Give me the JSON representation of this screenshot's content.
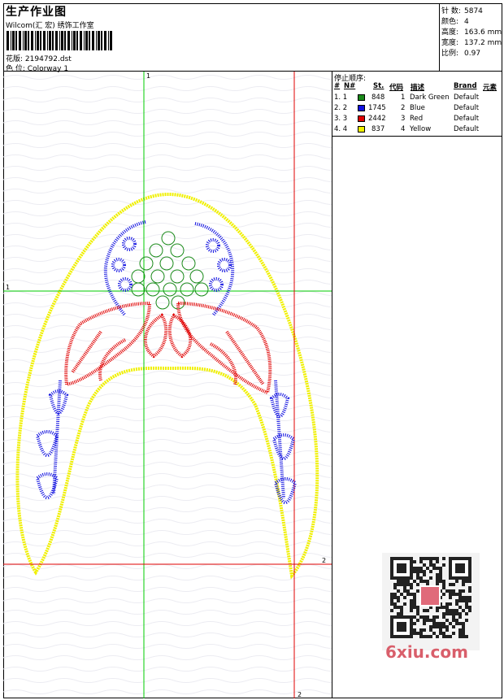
{
  "header": {
    "title": "生产作业图",
    "subtitle": "Wilcom(汇 宏) 绣饰工作室",
    "design_label": "花版:",
    "design_value": "2194792.dst",
    "colorway_label": "色 位:",
    "colorway_value": "Colorway 1"
  },
  "specs": [
    {
      "label": "针 数:",
      "value": "5874"
    },
    {
      "label": "颜色:",
      "value": "4"
    },
    {
      "label": "高度:",
      "value": "163.6 mm"
    },
    {
      "label": "宽度:",
      "value": "137.2 mm"
    },
    {
      "label": "比例:",
      "value": "0.97"
    }
  ],
  "legend": {
    "title": "停止顺序:",
    "columns": [
      "#",
      "N#",
      "St.",
      "代码",
      "描述",
      "Brand",
      "元素"
    ],
    "rows": [
      {
        "index": "1. 1",
        "color": "#1a8a1a",
        "stitches": "848",
        "code": "1",
        "desc": "Dark Green",
        "brand": "Default"
      },
      {
        "index": "2. 2",
        "color": "#1010e0",
        "stitches": "1745",
        "code": "2",
        "desc": "Blue",
        "brand": "Default"
      },
      {
        "index": "3. 3",
        "color": "#e00000",
        "stitches": "2442",
        "code": "3",
        "desc": "Red",
        "brand": "Default"
      },
      {
        "index": "4. 4",
        "color": "#f0f000",
        "stitches": "837",
        "code": "4",
        "desc": "Yellow",
        "brand": "Default"
      }
    ]
  },
  "guides": {
    "green_v_label": "1",
    "green_h_label": "1",
    "red_h_label": "2",
    "red_v_label": "2"
  },
  "watermark": "6xiu.com"
}
